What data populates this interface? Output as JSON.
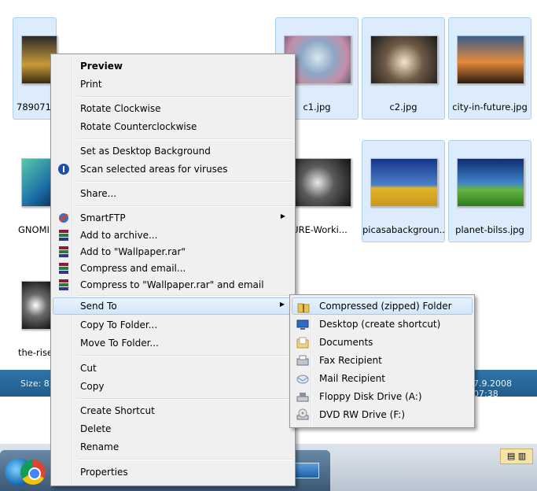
{
  "explorer": {
    "thumbs": [
      {
        "caption": "789071_"
      },
      {
        "caption": ""
      },
      {
        "caption": ""
      },
      {
        "caption": "c1.jpg"
      },
      {
        "caption": "c2.jpg"
      },
      {
        "caption": "city-in-future.jpg"
      },
      {
        "caption": "GNOMI"
      },
      {
        "caption": ""
      },
      {
        "caption": ""
      },
      {
        "caption": "TURE-Worki..."
      },
      {
        "caption": "picasabackgroun..."
      },
      {
        "caption": "planet-bilss.jpg"
      },
      {
        "caption": "the-rise"
      }
    ],
    "status_size": "Size: 8,",
    "status_date": "7.9.2008 07:38"
  },
  "context_menu": {
    "preview": "Preview",
    "print": "Print",
    "rotate_cw": "Rotate Clockwise",
    "rotate_ccw": "Rotate Counterclockwise",
    "set_background": "Set as Desktop Background",
    "scan_viruses": "Scan selected areas for viruses",
    "share": "Share...",
    "smartftp": "SmartFTP",
    "add_archive": "Add to archive...",
    "add_rar": "Add to \"Wallpaper.rar\"",
    "compress_email": "Compress and email...",
    "compress_rar_email": "Compress to \"Wallpaper.rar\" and email",
    "send_to": "Send To",
    "copy_to_folder": "Copy To Folder...",
    "move_to_folder": "Move To Folder...",
    "cut": "Cut",
    "copy": "Copy",
    "create_shortcut": "Create Shortcut",
    "delete": "Delete",
    "rename": "Rename",
    "properties": "Properties"
  },
  "send_to_menu": {
    "compressed_folder": "Compressed (zipped) Folder",
    "desktop": "Desktop (create shortcut)",
    "documents": "Documents",
    "fax": "Fax Recipient",
    "mail": "Mail Recipient",
    "floppy": "Floppy Disk Drive (A:)",
    "dvd": "DVD RW Drive (F:)"
  }
}
